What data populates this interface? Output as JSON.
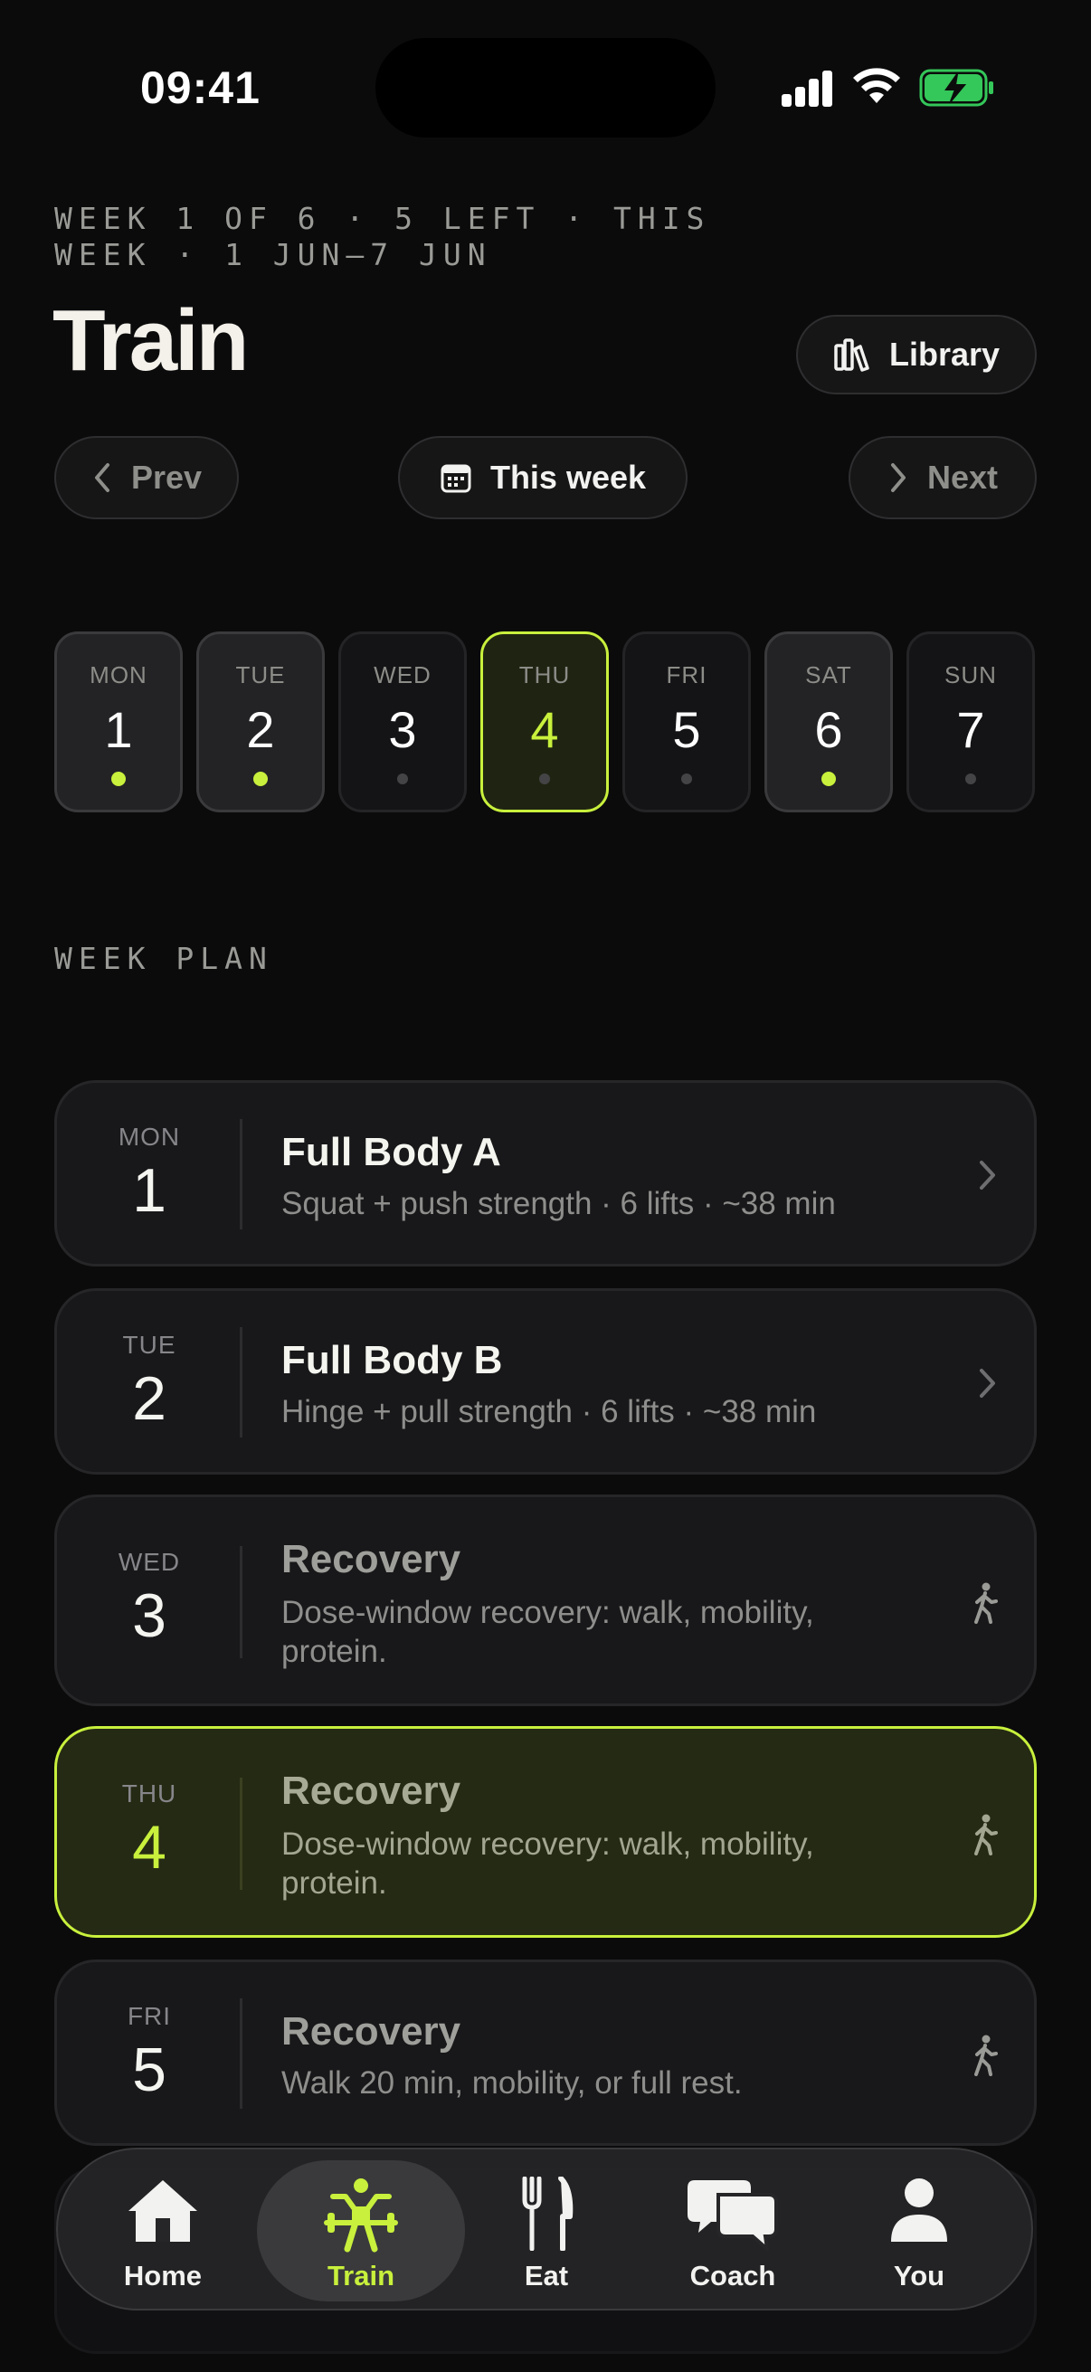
{
  "status": {
    "time": "09:41"
  },
  "header": {
    "eyebrow": "WEEK 1 OF 6 · 5 LEFT · THIS WEEK · 1 JUN–7 JUN",
    "title": "Train",
    "library_label": "Library"
  },
  "nav": {
    "prev": "Prev",
    "this_week": "This week",
    "next": "Next"
  },
  "days": [
    {
      "name": "MON",
      "date": "1",
      "done": true
    },
    {
      "name": "TUE",
      "date": "2",
      "done": true
    },
    {
      "name": "WED",
      "date": "3",
      "done": false
    },
    {
      "name": "THU",
      "date": "4",
      "done": false,
      "selected": true
    },
    {
      "name": "FRI",
      "date": "5",
      "done": false
    },
    {
      "name": "SAT",
      "date": "6",
      "done": true
    },
    {
      "name": "SUN",
      "date": "7",
      "done": false
    }
  ],
  "week_plan": {
    "label": "WEEK PLAN",
    "items": [
      {
        "day": "MON",
        "date": "1",
        "title": "Full Body A",
        "subtitle": "Squat + push strength · 6 lifts · ~38 min",
        "icon": "chevron-right-icon"
      },
      {
        "day": "TUE",
        "date": "2",
        "title": "Full Body B",
        "subtitle": "Hinge + pull strength · 6 lifts · ~38 min",
        "icon": "chevron-right-icon"
      },
      {
        "day": "WED",
        "date": "3",
        "title": "Recovery",
        "subtitle": "Dose-window recovery: walk, mobility, protein.",
        "icon": "walking-icon"
      },
      {
        "day": "THU",
        "date": "4",
        "title": "Recovery",
        "subtitle": "Dose-window recovery: walk, mobility, protein.",
        "icon": "walking-icon"
      },
      {
        "day": "FRI",
        "date": "5",
        "title": "Recovery",
        "subtitle": "Walk 20 min, mobility, or full rest.",
        "icon": "walking-icon"
      }
    ]
  },
  "tabs": [
    {
      "label": "Home",
      "icon": "home-icon"
    },
    {
      "label": "Train",
      "icon": "weightlifter-icon",
      "active": true
    },
    {
      "label": "Eat",
      "icon": "fork-knife-icon"
    },
    {
      "label": "Coach",
      "icon": "chat-bubbles-icon"
    },
    {
      "label": "You",
      "icon": "person-icon"
    }
  ],
  "colors": {
    "accent": "#c8f03c",
    "background": "#0b0b0c",
    "card": "#18181a"
  }
}
